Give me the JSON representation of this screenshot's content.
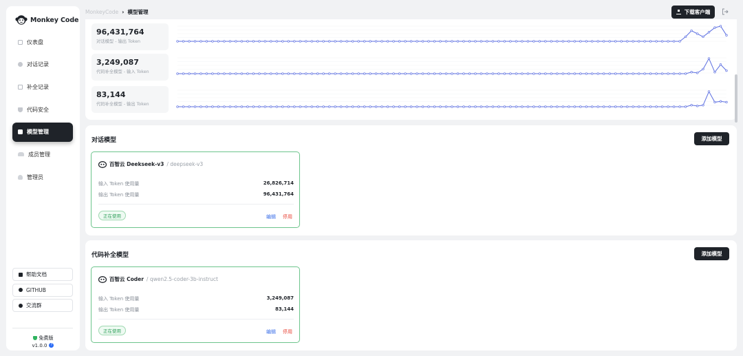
{
  "app": {
    "name": "Monkey Code"
  },
  "sidebar": {
    "items": [
      {
        "label": "仪表盘",
        "icon": "dashboard-icon"
      },
      {
        "label": "对话记录",
        "icon": "chat-icon"
      },
      {
        "label": "补全记录",
        "icon": "document-icon"
      },
      {
        "label": "代码安全",
        "icon": "shield-icon"
      },
      {
        "label": "模型管理",
        "icon": "cube-icon",
        "active": true
      },
      {
        "label": "成员管理",
        "icon": "users-icon"
      },
      {
        "label": "管理员",
        "icon": "user-icon"
      }
    ],
    "bottom_links": [
      {
        "label": "帮助文档",
        "icon": "book-icon"
      },
      {
        "label": "GITHUB",
        "icon": "github-icon"
      },
      {
        "label": "交流群",
        "icon": "group-icon"
      }
    ],
    "edition": "免费版",
    "version": "v1.0.0"
  },
  "header": {
    "breadcrumb_root": "MonkeyCode",
    "breadcrumb_sep": "›",
    "breadcrumb_current": "模型管理",
    "download_label": "下载客户端"
  },
  "stats": [
    {
      "value": "96,431,764",
      "label": "对话模型 - 输出 Token"
    },
    {
      "value": "3,249,087",
      "label": "代码补全模型 - 输入 Token"
    },
    {
      "value": "83,144",
      "label": "代码补全模型 - 输出 Token"
    }
  ],
  "sparklines": [
    {
      "series_tail": [
        0,
        0,
        0,
        0.3,
        0.7,
        0.5,
        0.3,
        0.6,
        0.9,
        1.0,
        0.4
      ]
    },
    {
      "series_tail": [
        0,
        0,
        0,
        0.1,
        0.05,
        0.3,
        1.0,
        0.1,
        0.6,
        0.2
      ]
    },
    {
      "series_tail": [
        0,
        0,
        0,
        0.1,
        0.05,
        0.1,
        1.0,
        0.3,
        0.35,
        0.3
      ]
    }
  ],
  "chat_section": {
    "title": "对话模型",
    "add_label": "添加模型",
    "card": {
      "name": "百智云 Deekseek-v3",
      "model_id": "/ deepseek-v3",
      "input_label": "输入 Token 使用量",
      "input_value": "26,826,714",
      "output_label": "输出 Token 使用量",
      "output_value": "96,431,764",
      "status": "正在使用",
      "edit_label": "编辑",
      "disable_label": "停用"
    }
  },
  "code_section": {
    "title": "代码补全模型",
    "add_label": "添加模型",
    "card": {
      "name": "百智云 Coder",
      "model_id": "/ qwen2.5-coder-3b-instruct",
      "input_label": "输入 Token 使用量",
      "input_value": "3,249,087",
      "output_label": "输出 Token 使用量",
      "output_value": "83,144",
      "status": "正在使用",
      "edit_label": "编辑",
      "disable_label": "停用"
    }
  },
  "colors": {
    "accent_dark": "#1f2329",
    "line_blue": "#5b6ee1",
    "active_green": "#2fa05a",
    "link_blue": "#3a6ee8",
    "danger_red": "#e8473a"
  }
}
